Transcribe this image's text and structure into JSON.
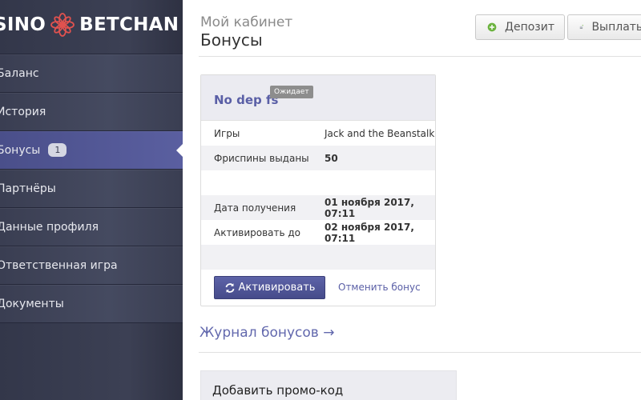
{
  "logo": {
    "left_text": "SINO",
    "right_text": "BETCHAN"
  },
  "sidebar": {
    "items": [
      {
        "label": "Баланс"
      },
      {
        "label": "История"
      },
      {
        "label": "Бонусы",
        "badge": "1",
        "active": true
      },
      {
        "label": "Партнёры"
      },
      {
        "label": "Данные профиля"
      },
      {
        "label": "Ответственная игра"
      },
      {
        "label": "Документы"
      }
    ]
  },
  "header": {
    "pre_title": "Мой кабинет",
    "title": "Бонусы",
    "deposit_label": "Депозит",
    "payout_label": "Выплаты"
  },
  "bonus_card": {
    "title": "No dep fs",
    "status": "Ожидает",
    "rows": [
      {
        "key": "Игры",
        "value": "Jack and the Beanstalk"
      },
      {
        "key": "Фриспины выданы",
        "value": "50"
      },
      {
        "key": "Дата получения",
        "value": "01 ноября 2017, 07:11"
      },
      {
        "key": "Активировать до",
        "value": "02 ноября 2017, 07:11"
      }
    ],
    "activate_label": "Активировать",
    "cancel_label": "Отменить бонус"
  },
  "journal_link": "Журнал бонусов →",
  "promo": {
    "title": "Добавить промо-код"
  },
  "colors": {
    "accent": "#5a5fa6",
    "sidebar": "#3c4054",
    "active": "#5a5fa0",
    "flower": "#e0524f"
  },
  "icons": {
    "deposit": "plus-circle-icon",
    "payout": "coins-icon",
    "activate": "refresh-icon",
    "logo": "flower-icon"
  }
}
